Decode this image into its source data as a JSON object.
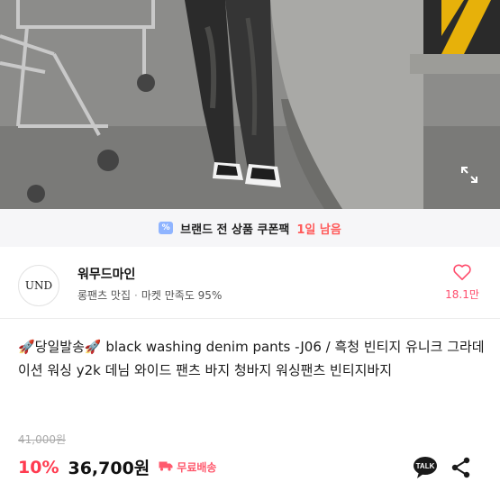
{
  "coupon": {
    "icon": "percent-coupon-icon",
    "text": "브랜드 전 상품 쿠폰팩",
    "remaining": "1일 남음"
  },
  "store": {
    "logo_text": "UND",
    "name": "워무드마인",
    "category": "롱팬츠 맛집",
    "satisfaction": "마켓 만족도 95%",
    "fav_count": "18.1만"
  },
  "product": {
    "title": "🚀당일발송🚀 black washing denim pants -J06 / 흑청 빈티지 유니크 그라데이션 워싱 y2k 데님 와이드 팬츠 바지 청바지 워싱팬츠 빈티지바지",
    "original_price": "41,000원",
    "discount": "10%",
    "price": "36,700원",
    "shipping": "무료배송"
  },
  "talk_label": "TALK",
  "colors": {
    "discount": "#ff3b50",
    "favorite": "#ff4d6d",
    "coupon_accent": "#ff5a5a"
  }
}
